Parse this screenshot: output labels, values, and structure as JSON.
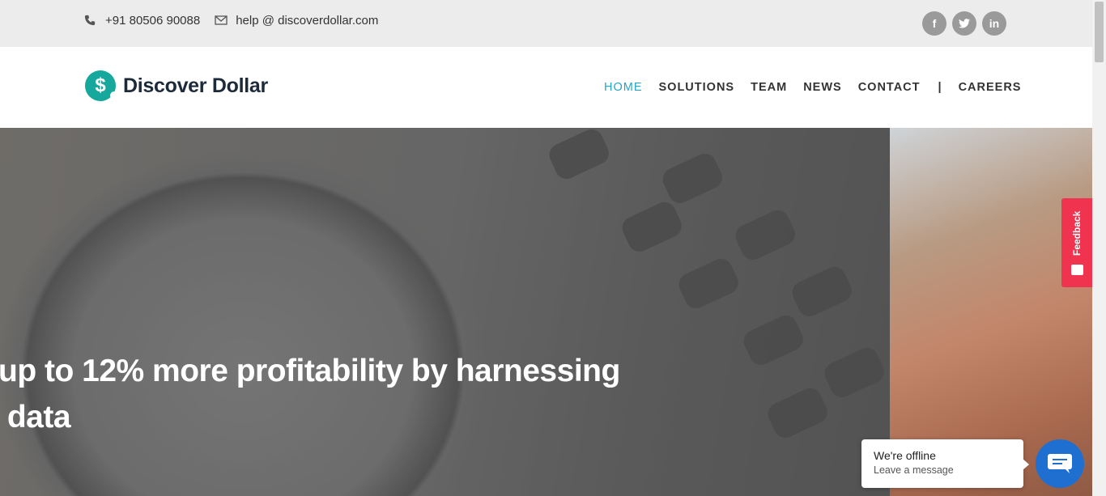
{
  "topbar": {
    "phone": "+91 80506 90088",
    "email": "help @ discoverdollar.com",
    "social": [
      {
        "icon": "facebook-icon",
        "glyph": "f"
      },
      {
        "icon": "twitter-icon",
        "glyph": "t"
      },
      {
        "icon": "linkedin-icon",
        "glyph": "in"
      }
    ]
  },
  "header": {
    "logo_text": "Discover Dollar",
    "logo_glyph": "$",
    "nav": [
      {
        "label": "HOME",
        "active": true
      },
      {
        "label": "SOLUTIONS"
      },
      {
        "label": "TEAM"
      },
      {
        "label": "NEWS"
      },
      {
        "label": "CONTACT"
      }
    ],
    "separator": "|",
    "careers": "CAREERS"
  },
  "hero": {
    "headline_line1": " up to 12% more profitability by harnessing",
    "headline_line2": "f data"
  },
  "feedback": {
    "label": "Feedback"
  },
  "chat": {
    "status": "We're offline",
    "prompt": "Leave a message"
  },
  "colors": {
    "accent": "#22a6c7",
    "brand": "#16a79d",
    "feedback": "#f0334f",
    "chat": "#1e6fd0"
  }
}
